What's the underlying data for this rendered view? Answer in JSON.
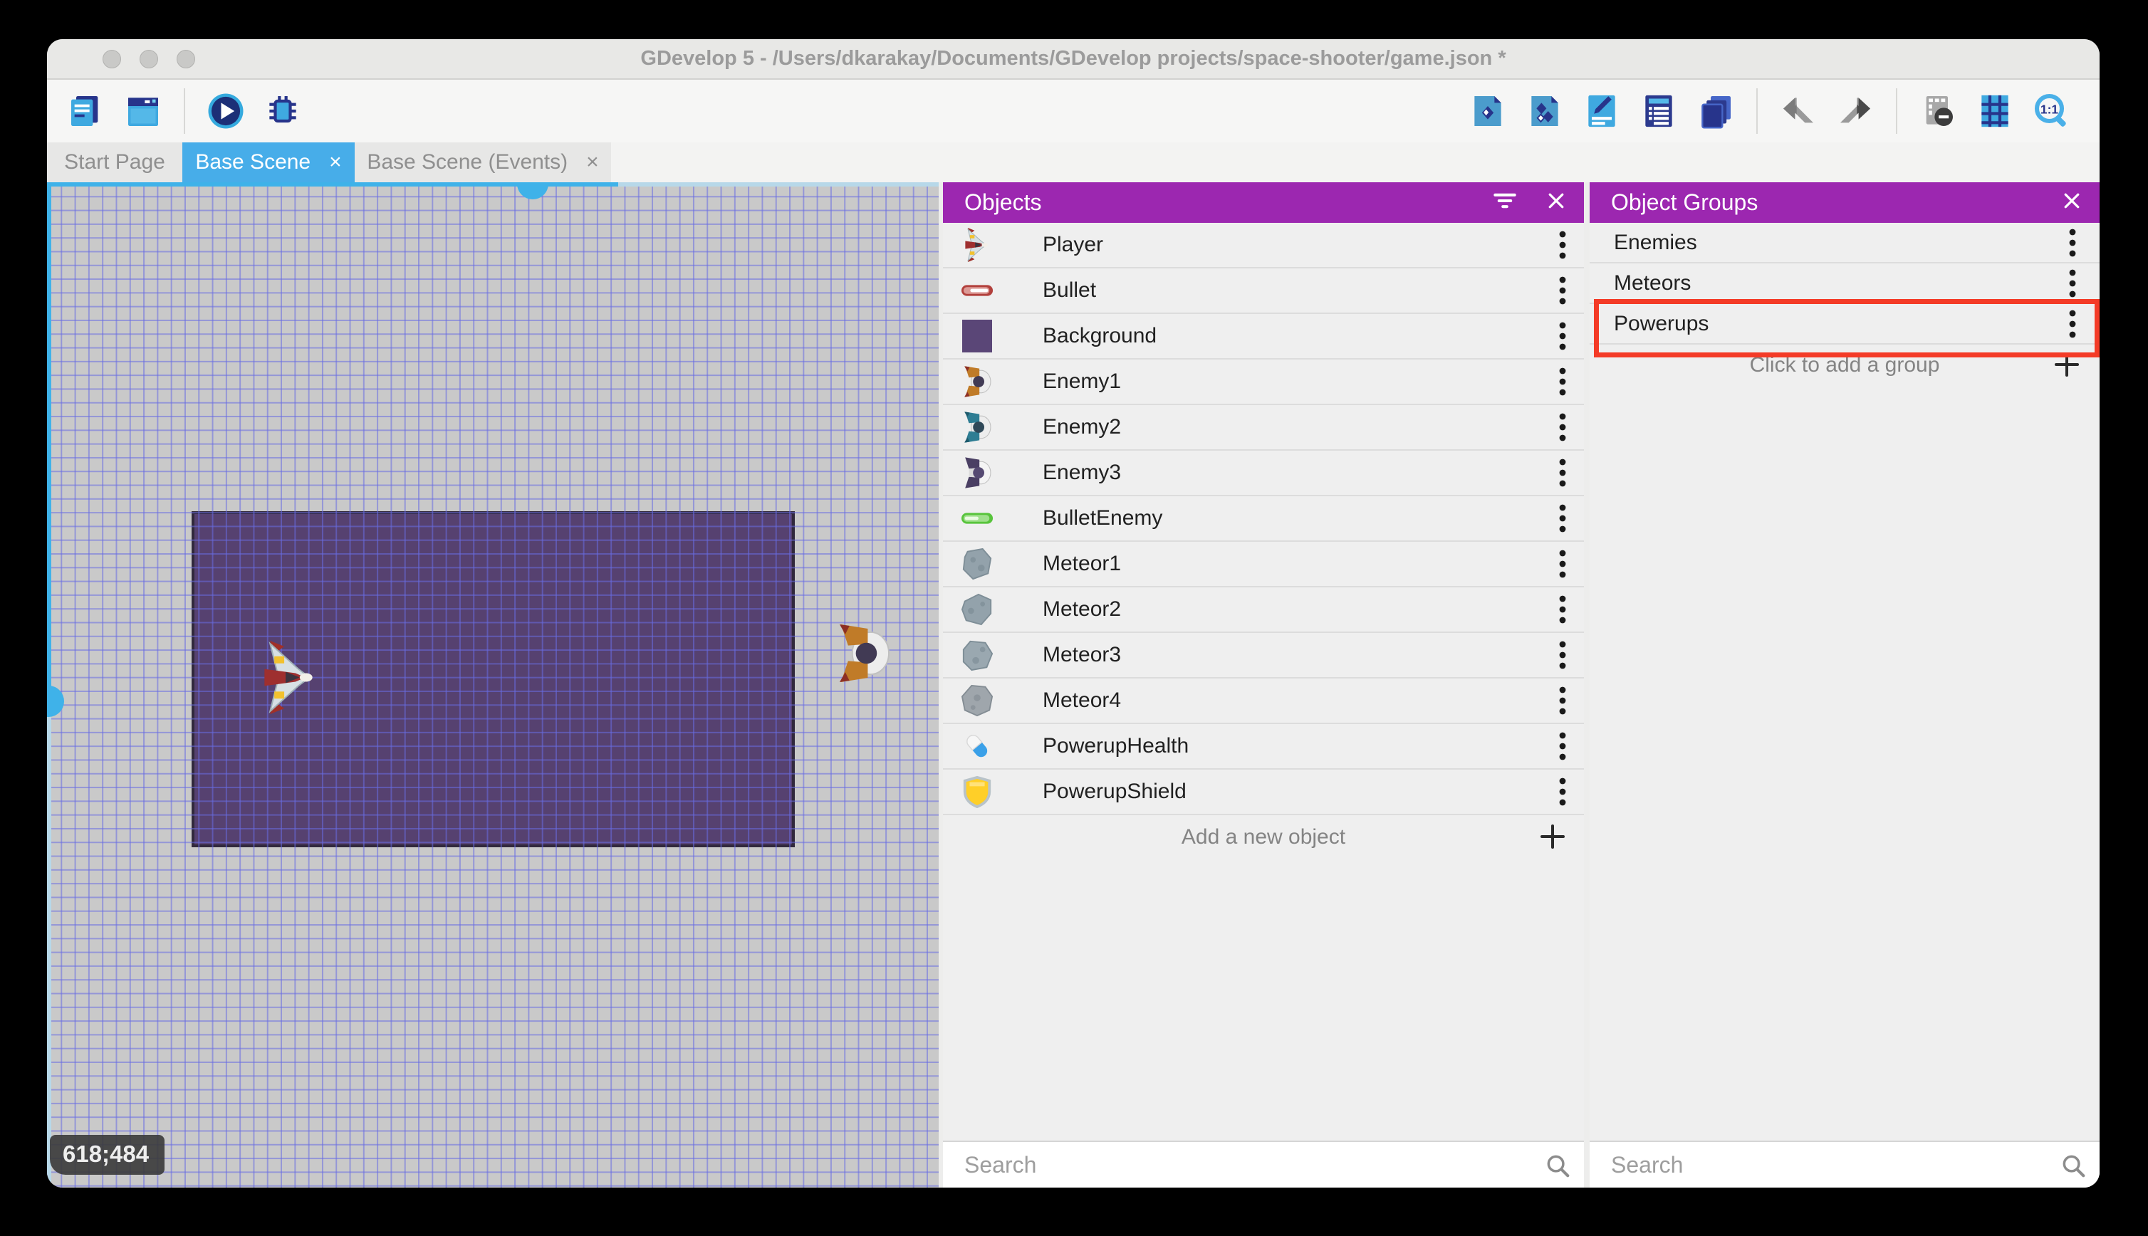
{
  "window": {
    "title": "GDevelop 5 - /Users/dkarakay/Documents/GDevelop projects/space-shooter/game.json *",
    "traffic_lights": [
      "close",
      "minimize",
      "zoom"
    ]
  },
  "toolbar": {
    "left_icons": [
      "project-manager",
      "start-page",
      "preview-play",
      "debug-bug"
    ],
    "right_icons": [
      "objects-editor",
      "object-groups-editor",
      "properties",
      "instances-list",
      "layers",
      "undo",
      "redo",
      "toggle-window-mask",
      "toggle-grid",
      "zoom-1-1"
    ]
  },
  "tabs": [
    {
      "label": "Start Page",
      "active": false,
      "closable": false
    },
    {
      "label": "Base Scene",
      "active": true,
      "closable": true,
      "close_glyph": "×"
    },
    {
      "label": "Base Scene (Events)",
      "active": false,
      "closable": true,
      "close_glyph": "×"
    }
  ],
  "canvas": {
    "coordinate_indicator": "618;484",
    "grid_color": "#686ce2",
    "background_object_color": "#564170",
    "scrollbar_color": "#3fb2e9"
  },
  "objects_panel": {
    "title": "Objects",
    "items": [
      {
        "label": "Player",
        "icon": "player-ship"
      },
      {
        "label": "Bullet",
        "icon": "red-bullet"
      },
      {
        "label": "Background",
        "icon": "purple-square"
      },
      {
        "label": "Enemy1",
        "icon": "orange-ship"
      },
      {
        "label": "Enemy2",
        "icon": "teal-ship"
      },
      {
        "label": "Enemy3",
        "icon": "purple-ship"
      },
      {
        "label": "BulletEnemy",
        "icon": "green-bullet"
      },
      {
        "label": "Meteor1",
        "icon": "meteor-rock"
      },
      {
        "label": "Meteor2",
        "icon": "meteor-rock"
      },
      {
        "label": "Meteor3",
        "icon": "meteor-rock"
      },
      {
        "label": "Meteor4",
        "icon": "meteor-rock"
      },
      {
        "label": "PowerupHealth",
        "icon": "blue-pill"
      },
      {
        "label": "PowerupShield",
        "icon": "yellow-shield"
      }
    ],
    "add_label": "Add a new object",
    "search_placeholder": "Search"
  },
  "object_groups_panel": {
    "title": "Object Groups",
    "groups": [
      {
        "label": "Enemies"
      },
      {
        "label": "Meteors"
      },
      {
        "label": "Powerups"
      }
    ],
    "highlighted_group": "Powerups",
    "highlight_color": "#f43b27",
    "add_label": "Click to add a group",
    "search_placeholder": "Search"
  },
  "colors": {
    "panel_header": "#9c27b0",
    "active_tab": "#47ade9",
    "canvas_bg": "#c9c9c9"
  }
}
